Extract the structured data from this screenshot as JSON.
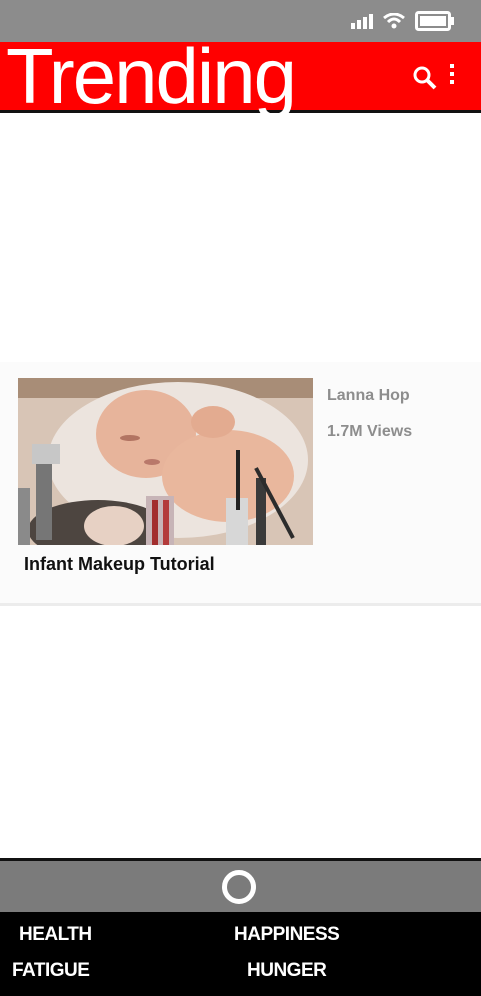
{
  "status_bar": {
    "icons": [
      "signal-icon",
      "wifi-icon",
      "battery-icon"
    ]
  },
  "header": {
    "title": "Trending",
    "icons": [
      "search-icon",
      "menu-icon"
    ],
    "background": "#ff0000"
  },
  "video": {
    "channel": "Lanna Hop",
    "views": "1.7M Views",
    "title": "Infant Makeup Tutorial"
  },
  "bottom_bar": {
    "icon": "home-icon"
  },
  "stats": {
    "health": "HEALTH",
    "happiness": "HAPPINESS",
    "fatigue": "FATIGUE",
    "hunger": "HUNGER"
  }
}
